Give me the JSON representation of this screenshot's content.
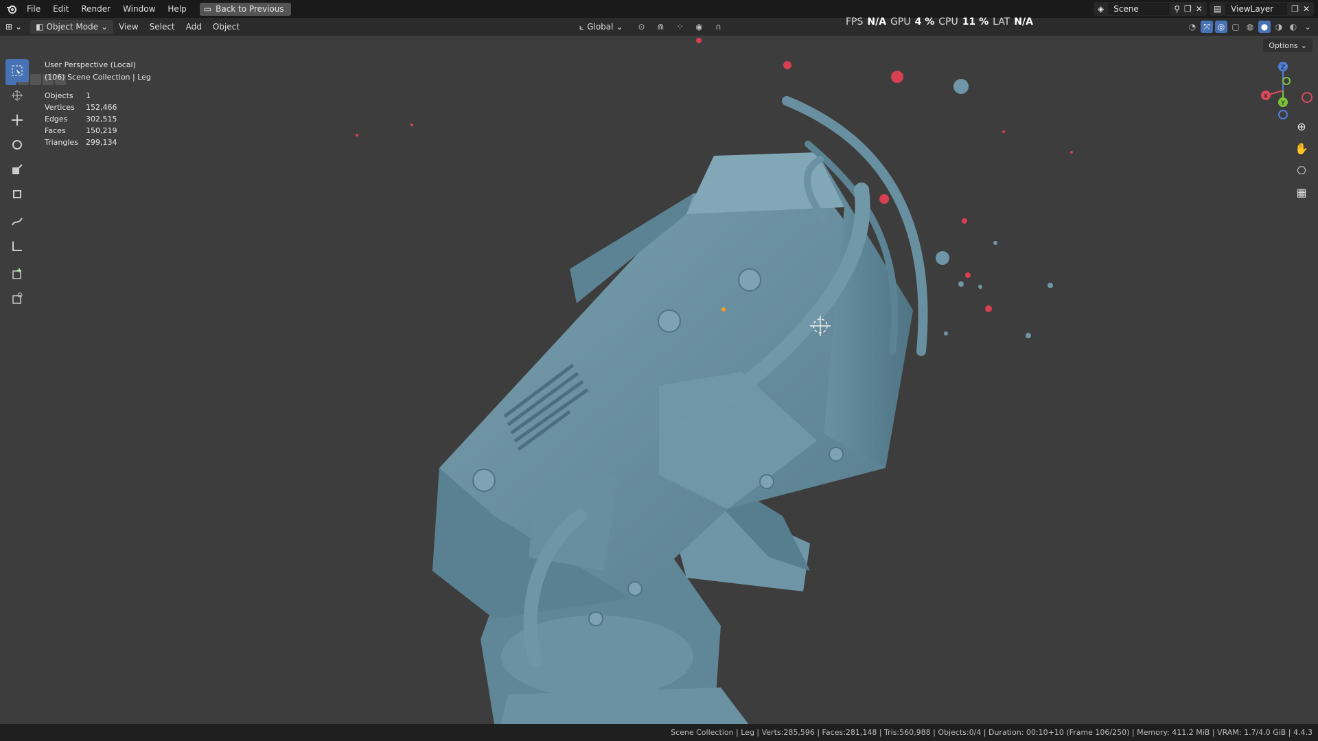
{
  "topbar": {
    "menus": [
      "File",
      "Edit",
      "Render",
      "Window",
      "Help"
    ],
    "back_label": "Back to Previous",
    "scene_label": "Scene",
    "viewlayer_label": "ViewLayer"
  },
  "header": {
    "mode_label": "Object Mode",
    "menus": [
      "View",
      "Select",
      "Add",
      "Object"
    ],
    "transform_orientation": "Global"
  },
  "perf": {
    "fps_label": "FPS",
    "fps_value": "N/A",
    "gpu_label": "GPU",
    "gpu_value": "4 %",
    "cpu_label": "CPU",
    "cpu_value": "11 %",
    "lat_label": "LAT",
    "lat_value": "N/A"
  },
  "viewport": {
    "perspective": "User Perspective (Local)",
    "collection": "(106) Scene Collection | Leg",
    "options_label": "Options",
    "stats": [
      {
        "key": "Objects",
        "value": "1"
      },
      {
        "key": "Vertices",
        "value": "152,466"
      },
      {
        "key": "Edges",
        "value": "302,515"
      },
      {
        "key": "Faces",
        "value": "150,219"
      },
      {
        "key": "Triangles",
        "value": "299,134"
      }
    ],
    "gizmo": {
      "z": "Z",
      "y": "Y",
      "x": "X"
    }
  },
  "status": {
    "text": "Scene Collection | Leg | Verts:285,596 | Faces:281,148 | Tris:560,988 | Objects:0/4 | Duration: 00:10+10 (Frame 106/250) | Memory: 411.2 MiB | VRAM: 1.7/4.0 GiB | 4.4.3"
  },
  "colors": {
    "accent": "#4772b3",
    "mesh": "#5f8a9a",
    "background": "#3d3d3d"
  }
}
